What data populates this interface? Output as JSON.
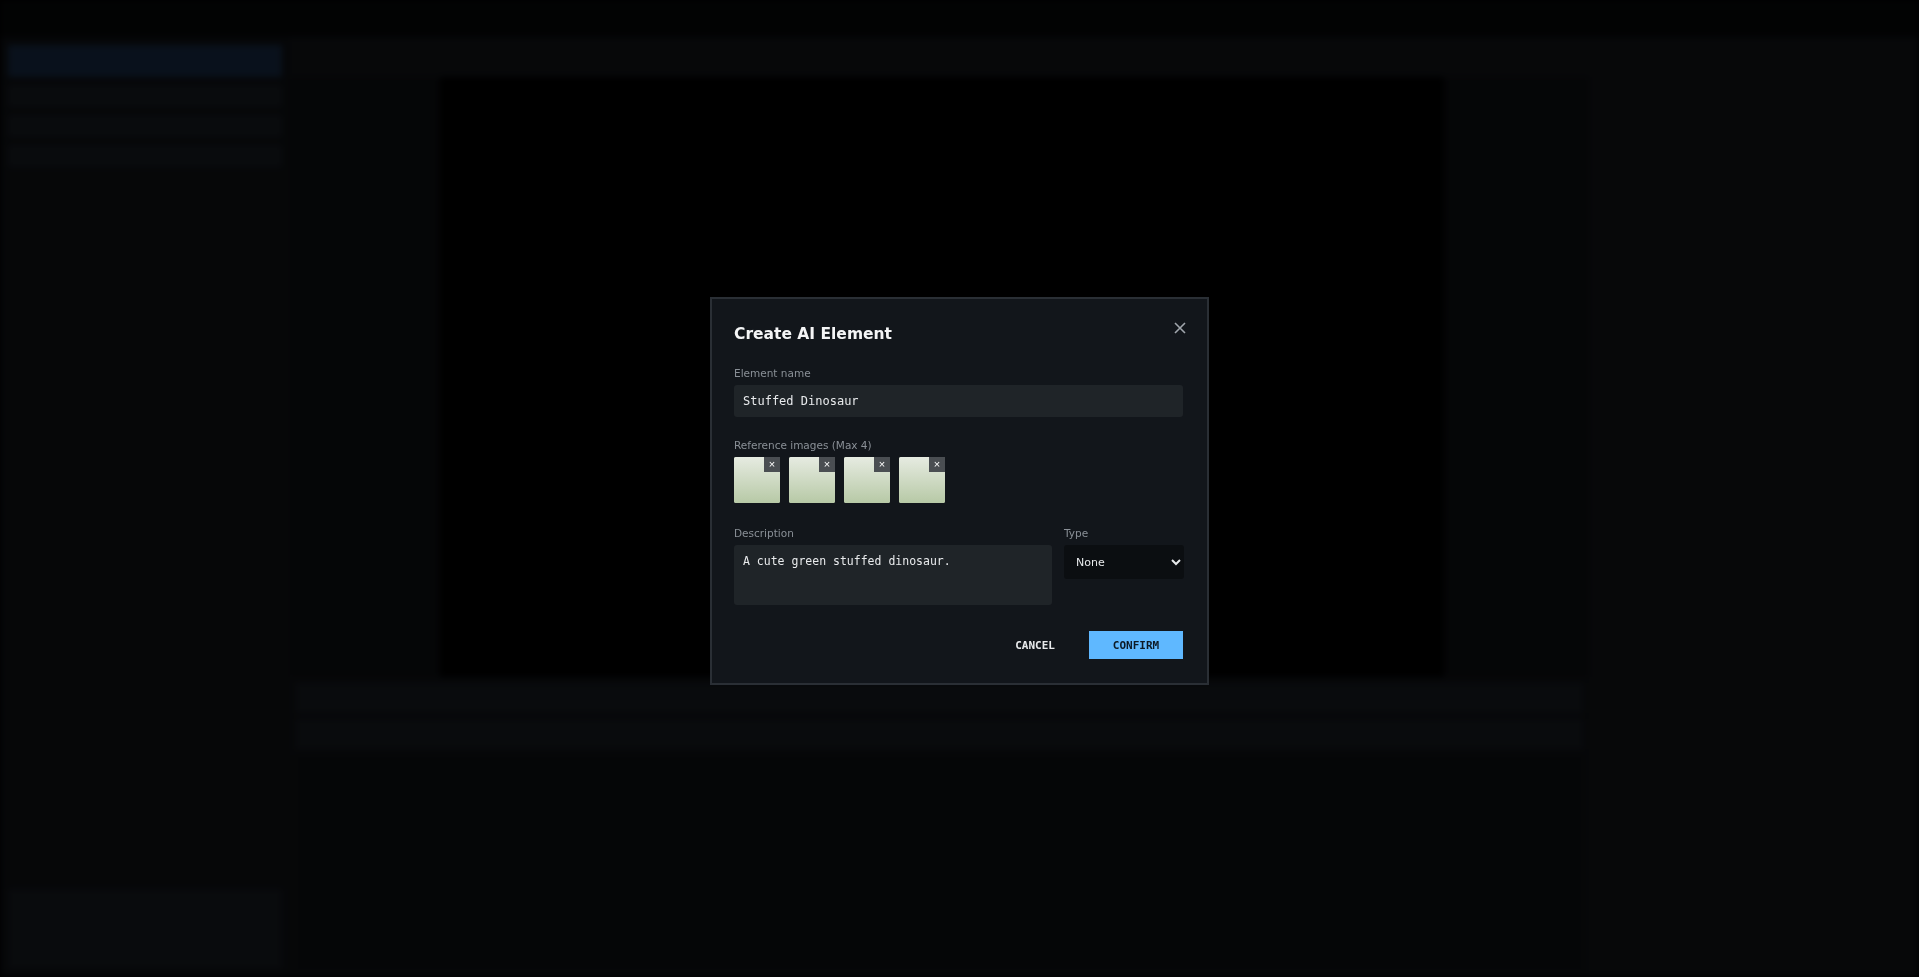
{
  "dialog": {
    "title": "Create AI Element",
    "name_field": {
      "label": "Element name",
      "value": "Stuffed Dinosaur"
    },
    "reference_images": {
      "label": "Reference images (Max 4)",
      "items": [
        {
          "remove": "×"
        },
        {
          "remove": "×"
        },
        {
          "remove": "×"
        },
        {
          "remove": "×"
        }
      ]
    },
    "description": {
      "label": "Description",
      "value": "A cute green stuffed dinosaur."
    },
    "type": {
      "label": "Type",
      "value": "None"
    },
    "buttons": [
      {
        "label": "CANCEL",
        "kind": "text"
      },
      {
        "label": "CONFIRM",
        "kind": "primary"
      }
    ]
  }
}
